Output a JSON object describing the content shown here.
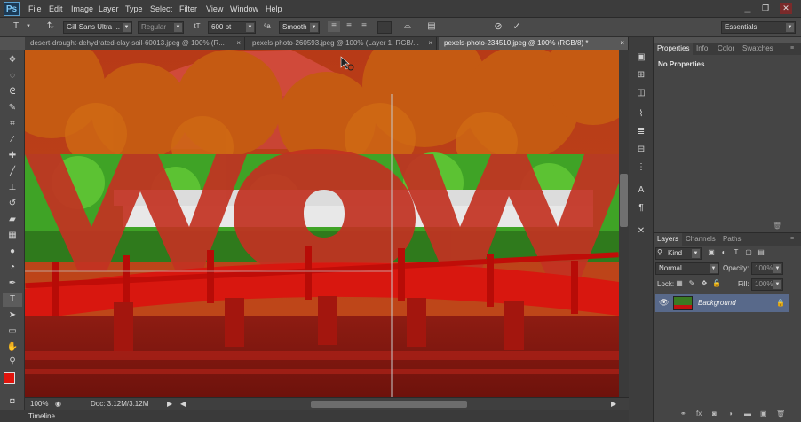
{
  "app": {
    "logo": "Ps"
  },
  "menu": [
    "File",
    "Edit",
    "Image",
    "Layer",
    "Type",
    "Select",
    "Filter",
    "View",
    "Window",
    "Help"
  ],
  "window_controls": {
    "minimize": "▁",
    "restore": "❐",
    "close": "✕"
  },
  "options": {
    "font_family": "Gill Sans Ultra ...",
    "font_style": "Regular",
    "font_size": "600 pt",
    "anti_alias": "Smooth",
    "workspace": "Essentials",
    "cancel_symbol": "⊘",
    "commit_symbol": "✓"
  },
  "tabs": [
    {
      "label": "desert-drought-dehydrated-clay-soil-60013.jpeg @ 100% (R...",
      "close": "×",
      "active": false
    },
    {
      "label": "pexels-photo-260593.jpeg @ 100% (Layer 1, RGB/...",
      "close": "×",
      "active": false
    },
    {
      "label": "pexels-photo-234510.jpeg @ 100% (RGB/8) *",
      "close": "×",
      "active": true
    }
  ],
  "status": {
    "zoom": "100%",
    "doc": "Doc: 3.12M/3.12M"
  },
  "timeline": {
    "label": "Timeline"
  },
  "properties_panel": {
    "tabs": [
      "Properties",
      "Info",
      "Color",
      "Swatches"
    ],
    "content": "No Properties"
  },
  "layers_panel": {
    "tabs": [
      "Layers",
      "Channels",
      "Paths"
    ],
    "filter_kind": "Kind",
    "blend_mode": "Normal",
    "opacity_label": "Opacity:",
    "opacity_value": "100%",
    "lock_label": "Lock:",
    "fill_label": "Fill:",
    "fill_value": "100%",
    "layers": [
      {
        "name": "Background",
        "visible": true,
        "locked": true
      }
    ]
  },
  "colors": {
    "foreground": "#e0140c",
    "background": "#ffffff",
    "accent_layer": "#58698a"
  }
}
